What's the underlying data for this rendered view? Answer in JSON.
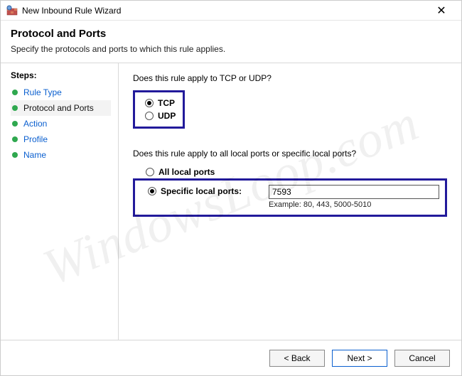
{
  "window": {
    "title": "New Inbound Rule Wizard"
  },
  "header": {
    "title": "Protocol and Ports",
    "subtitle": "Specify the protocols and ports to which this rule applies."
  },
  "sidebar": {
    "label": "Steps:",
    "items": [
      {
        "label": "Rule Type"
      },
      {
        "label": "Protocol and Ports"
      },
      {
        "label": "Action"
      },
      {
        "label": "Profile"
      },
      {
        "label": "Name"
      }
    ],
    "current_index": 1
  },
  "content": {
    "question1": "Does this rule apply to TCP or UDP?",
    "protocol": {
      "tcp_label": "TCP",
      "udp_label": "UDP",
      "selected": "TCP"
    },
    "question2": "Does this rule apply to all local ports or specific local ports?",
    "port_scope": {
      "all_label": "All local ports",
      "specific_label": "Specific local ports:",
      "selected": "specific",
      "port_value": "7593",
      "example": "Example: 80, 443, 5000-5010"
    }
  },
  "footer": {
    "back": "< Back",
    "next": "Next >",
    "cancel": "Cancel"
  },
  "watermark": "WindowsLoop.com"
}
